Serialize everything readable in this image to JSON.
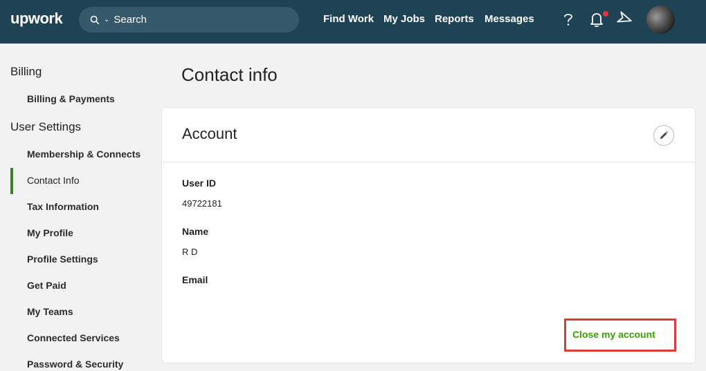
{
  "header": {
    "logo": "upwork",
    "search_placeholder": "Search",
    "nav": [
      "Find Work",
      "My Jobs",
      "Reports",
      "Messages"
    ],
    "icons": [
      "help-icon",
      "bell-icon",
      "send-icon"
    ]
  },
  "sidebar": {
    "billing_heading": "Billing",
    "billing_items": [
      "Billing & Payments"
    ],
    "settings_heading": "User Settings",
    "settings_items": [
      "Membership & Connects",
      "Contact Info",
      "Tax Information",
      "My Profile",
      "Profile Settings",
      "Get Paid",
      "My Teams",
      "Connected Services",
      "Password & Security"
    ],
    "active_item": "Contact Info"
  },
  "main": {
    "title": "Contact info",
    "card_title": "Account",
    "fields": [
      {
        "label": "User ID",
        "value": "49722181"
      },
      {
        "label": "Name",
        "value": "R D"
      },
      {
        "label": "Email",
        "value": ""
      }
    ],
    "close_account": "Close my account"
  },
  "colors": {
    "header_bg": "#1d4354",
    "accent_green": "#37a000",
    "active_bar": "#3c8224",
    "highlight_red": "#d93a3a",
    "notif_dot": "#e4343c"
  }
}
